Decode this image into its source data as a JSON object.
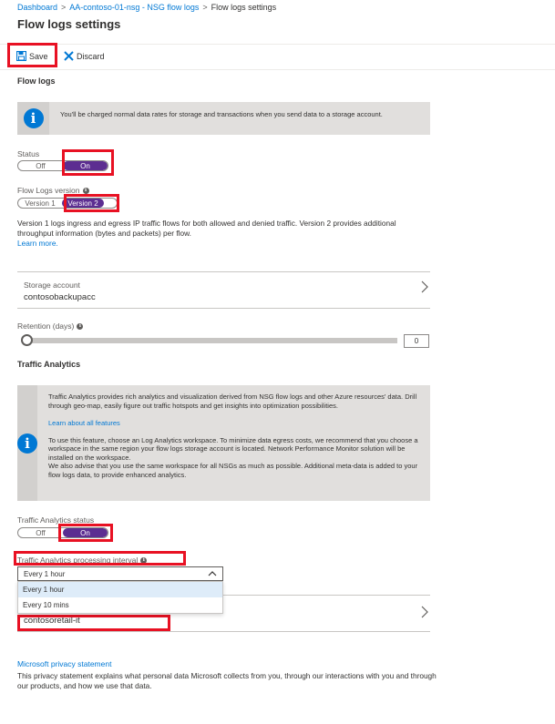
{
  "breadcrumb": {
    "items": [
      "Dashboard",
      "AA-contoso-01-nsg - NSG flow logs",
      "Flow logs settings"
    ],
    "separator": ">"
  },
  "page": {
    "title": "Flow logs settings"
  },
  "toolbar": {
    "save_label": "Save",
    "discard_label": "Discard"
  },
  "flow_logs": {
    "heading": "Flow logs",
    "info_text": "You'll be charged normal data rates for storage and transactions when you send data to a storage account.",
    "status_label": "Status",
    "status_off": "Off",
    "status_on": "On",
    "status_value": "On",
    "version_label": "Flow Logs version",
    "version1": "Version 1",
    "version2": "Version 2",
    "version_value": "Version 2",
    "version_desc": "Version 1 logs ingress and egress IP traffic flows for both allowed and denied traffic. Version 2 provides additional throughput information (bytes and packets) per flow.",
    "learn_more": "Learn more.",
    "storage_label": "Storage account",
    "storage_value": "contosobackupacc",
    "retention_label": "Retention (days)",
    "retention_value": "0"
  },
  "traffic_analytics": {
    "heading": "Traffic Analytics",
    "info_text_1": "Traffic Analytics provides rich analytics and visualization derived from NSG flow logs and other Azure resources' data. Drill through geo-map, easily figure out traffic hotspots and get insights into optimization possibilities.",
    "learn_about_link": "Learn about all features",
    "info_text_2": "To use this feature, choose an Log Analytics workspace. To minimize data egress costs, we recommend that you choose a workspace in the same region your flow logs storage account is located. Network Performance Monitor solution will be installed on the workspace.",
    "info_text_3": "We also advise that you use the same workspace for all NSGs as much as possible. Additional meta-data is added to your flow logs data, to provide enhanced analytics.",
    "status_label": "Traffic Analytics status",
    "status_off": "Off",
    "status_on": "On",
    "status_value": "On",
    "interval_label": "Traffic Analytics processing interval",
    "interval_value": "Every 1 hour",
    "interval_options": [
      "Every 1 hour",
      "Every 10 mins"
    ],
    "workspace_value": "contosoretail-it"
  },
  "privacy": {
    "link": "Microsoft privacy statement",
    "text": "This privacy statement explains what personal data Microsoft collects from you, through our interactions with you and through our products, and how we use that data."
  },
  "colors": {
    "accent": "#0078d4",
    "toggle_on": "#5c2d91",
    "highlight": "#e81123",
    "info_bg": "#e1dfdd"
  },
  "icons": [
    "save-icon",
    "discard-icon",
    "info-icon",
    "chevron-right-icon",
    "chevron-up-icon"
  ]
}
